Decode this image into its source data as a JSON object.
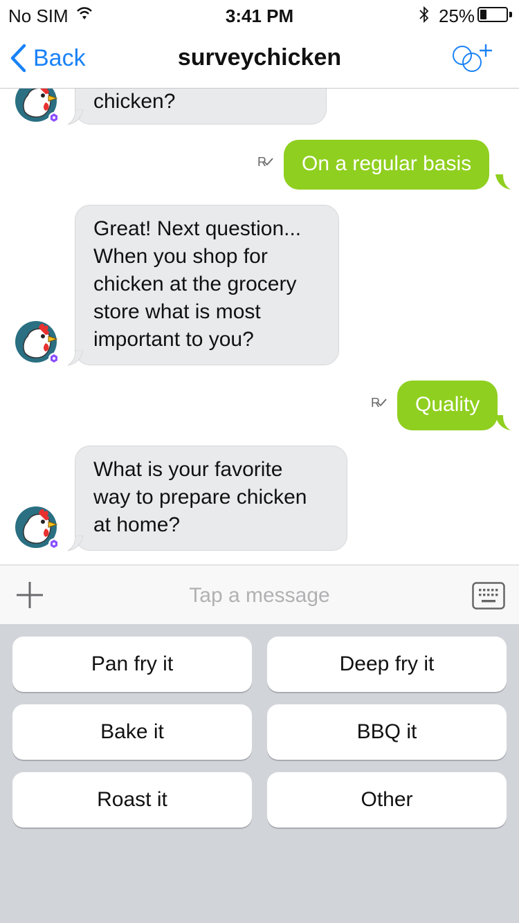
{
  "status_bar": {
    "carrier": "No SIM",
    "time": "3:41 PM",
    "battery_percent": "25%",
    "battery_level": 0.25,
    "icons": [
      "wifi-icon",
      "bluetooth-icon",
      "battery-icon"
    ]
  },
  "nav": {
    "back_label": "Back",
    "title": "surveychicken",
    "add_friend_icon": "add-friend-icon"
  },
  "colors": {
    "accent": "#1a82f7",
    "outgoing_bubble": "#8fcf1f",
    "incoming_bubble": "#e9eaec",
    "keyboard_panel": "#d1d4d9"
  },
  "messages": [
    {
      "direction": "incoming",
      "text": "chicken?"
    },
    {
      "direction": "outgoing",
      "text": "On a regular basis",
      "read_mark": "R"
    },
    {
      "direction": "incoming",
      "lines": [
        "Great! Next question...",
        "When you shop for",
        "chicken at the grocery",
        "store what is most",
        "important to you?"
      ]
    },
    {
      "direction": "outgoing",
      "text": "Quality",
      "read_mark": "R"
    },
    {
      "direction": "incoming",
      "lines": [
        "What is your favorite",
        "way to prepare chicken",
        "at home?"
      ]
    }
  ],
  "composer": {
    "placeholder": "Tap a message",
    "plus_icon": "plus-icon",
    "keyboard_icon": "keyboard-icon"
  },
  "quick_replies": [
    "Pan fry it",
    "Deep fry it",
    "Bake it",
    "BBQ it",
    "Roast it",
    "Other"
  ]
}
